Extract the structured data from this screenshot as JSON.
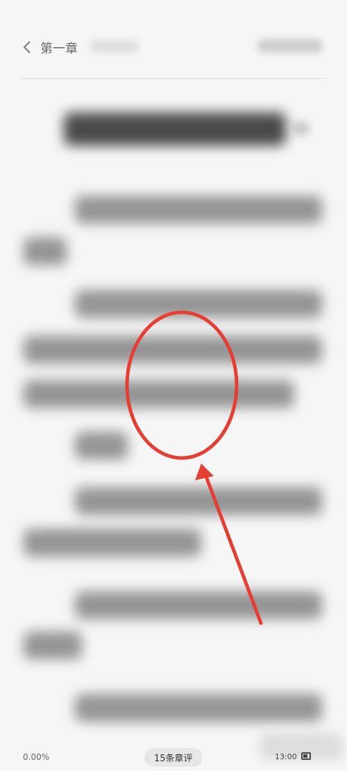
{
  "reader": {
    "chapter_label": "第一章",
    "progress": "0.00%",
    "comments_label": "15条章评",
    "time": "13:00"
  }
}
